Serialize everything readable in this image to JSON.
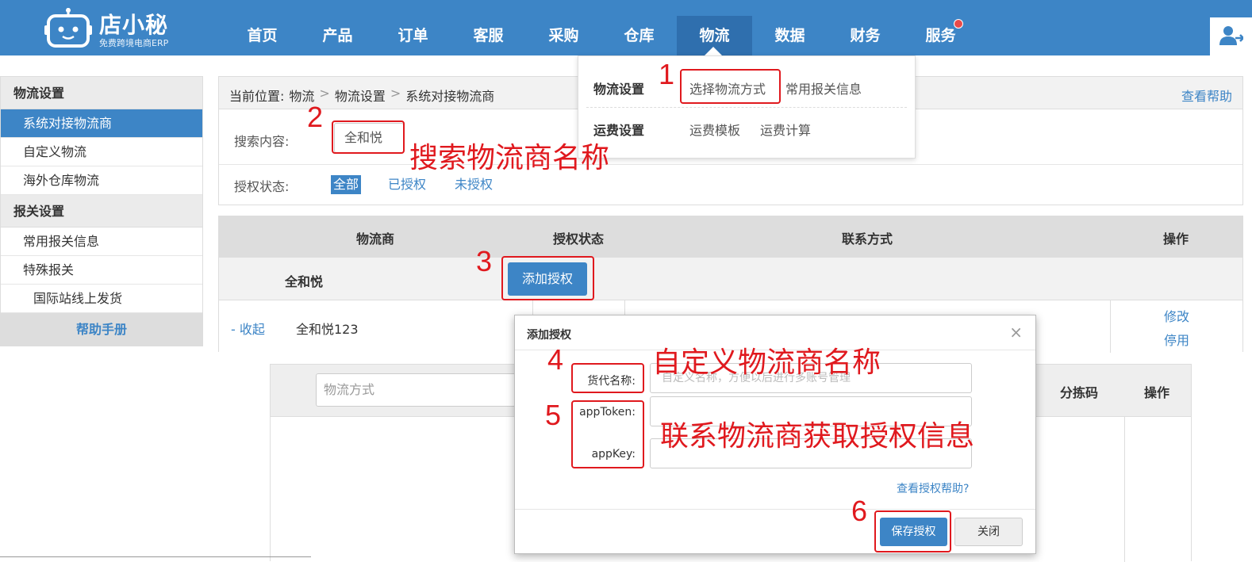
{
  "brand": {
    "name": "店小秘",
    "tagline": "免费跨境电商ERP"
  },
  "nav": {
    "items": [
      "首页",
      "产品",
      "订单",
      "客服",
      "采购",
      "仓库",
      "物流",
      "数据",
      "财务",
      "服务"
    ],
    "active_index": 6
  },
  "sidebar": {
    "section1": "物流设置",
    "items1": [
      "系统对接物流商",
      "自定义物流",
      "海外仓库物流"
    ],
    "section2": "报关设置",
    "items2": [
      "常用报关信息",
      "特殊报关"
    ],
    "sub_item": "国际站线上发货",
    "help": "帮助手册"
  },
  "breadcrumb": {
    "prefix": "当前位置:",
    "items": [
      "物流",
      "物流设置",
      "系统对接物流商"
    ],
    "sep": ">"
  },
  "help_link": "查看帮助",
  "search": {
    "label": "搜索内容:",
    "value": "全和悦"
  },
  "auth_filter": {
    "label": "授权状态:",
    "options": [
      "全部",
      "已授权",
      "未授权"
    ]
  },
  "table": {
    "headers": [
      "物流商",
      "授权状态",
      "联系方式",
      "操作"
    ],
    "group_name": "全和悦",
    "add_auth_button": "添加授权",
    "row": {
      "toggle": "- 收起",
      "name": "全和悦123",
      "actions": [
        "修改",
        "停用"
      ]
    }
  },
  "subtable": {
    "placeholder": "物流方式",
    "headers": [
      "分拣码",
      "操作"
    ]
  },
  "dropdown": {
    "row1_head": "物流设置",
    "row1_links": [
      "选择物流方式",
      "常用报关信息"
    ],
    "row2_head": "运费设置",
    "row2_links": [
      "运费模板",
      "运费计算"
    ]
  },
  "modal": {
    "title": "添加授权",
    "close": "×",
    "fields": [
      {
        "label": "货代名称:",
        "placeholder": "自定义名称，方便以后进行多账号管理"
      },
      {
        "label": "appToken:",
        "placeholder": ""
      },
      {
        "label": "appKey:",
        "placeholder": ""
      }
    ],
    "help_link": "查看授权帮助?",
    "save_button": "保存授权",
    "close_button": "关闭"
  },
  "annotations": {
    "numbers": [
      "1",
      "2",
      "3",
      "4",
      "5",
      "6"
    ],
    "texts": [
      "搜索物流商名称",
      "自定义物流商名称",
      "联系物流商获取授权信息"
    ],
    "color": "#e0191e"
  },
  "colors": {
    "primary": "#3d85c6",
    "nav_active": "#2f6fae",
    "annotation": "#e0191e"
  }
}
